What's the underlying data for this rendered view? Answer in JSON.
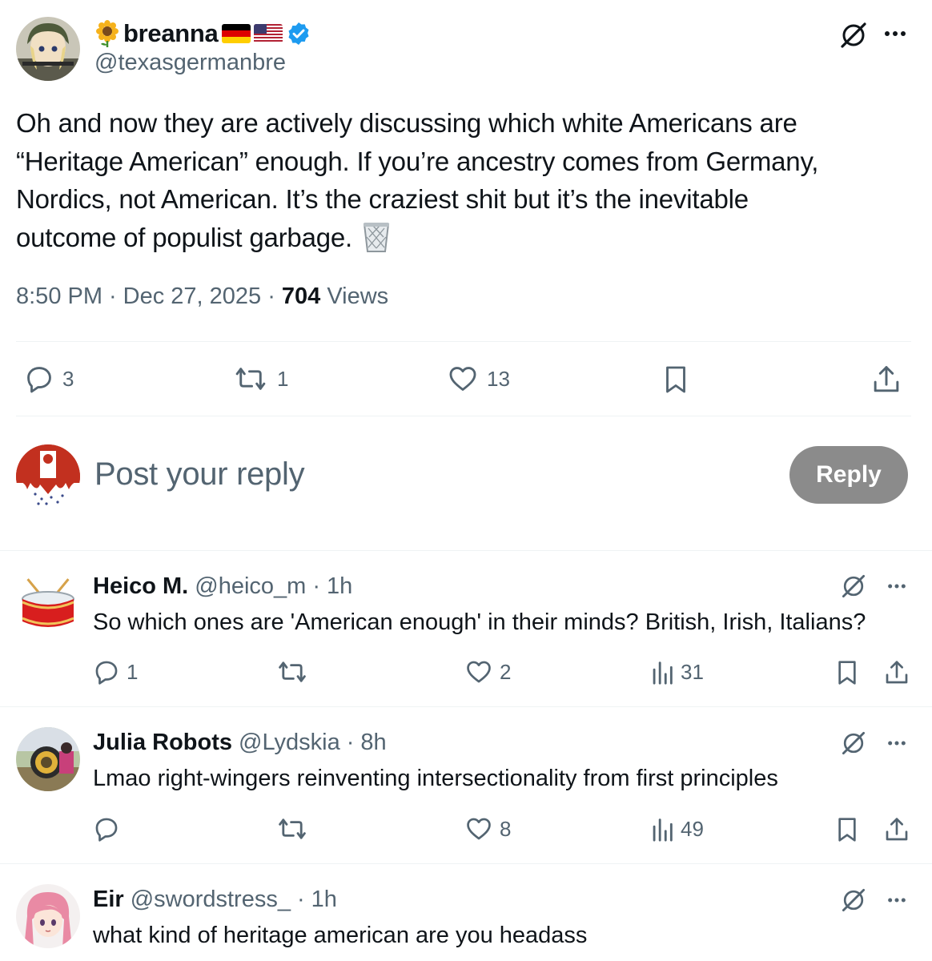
{
  "post": {
    "display_name": "breanna",
    "name_emoji": "sunflower-icon",
    "flags": [
      "germany-flag-icon",
      "us-flag-icon"
    ],
    "verified": "verified-badge-icon",
    "handle": "@texasgermanbre",
    "text_lines": [
      "Oh and now they are actively discussing which white Americans are",
      "“Heritage American” enough. If you’re ancestry comes from Germany,",
      "Nordics, not American. It’s the craziest shit but it’s the inevitable",
      "outcome of populist garbage."
    ],
    "trailing_emoji": "wastebasket-icon",
    "time": "8:50 PM",
    "dot": "·",
    "date": "Dec 27, 2025",
    "views_count": "704",
    "views_label": "Views",
    "stats": {
      "replies": "3",
      "reposts": "1",
      "likes": "13"
    }
  },
  "composer": {
    "placeholder": "Post your reply",
    "button_label": "Reply"
  },
  "replies": [
    {
      "name": "Heico M.",
      "handle": "@heico_m",
      "dot": "·",
      "time": "1h",
      "text": "So which ones are 'American enough' in their minds? British, Irish, Italians?",
      "avatar_icon": "drum-icon",
      "stats": {
        "replies": "1",
        "reposts": "",
        "likes": "2",
        "views": "31"
      }
    },
    {
      "name": "Julia Robots",
      "handle": "@Lydskia",
      "dot": "·",
      "time": "8h",
      "text": "Lmao right-wingers reinventing intersectionality from first principles",
      "avatar_icon": "robot-photo-avatar",
      "stats": {
        "replies": "",
        "reposts": "",
        "likes": "8",
        "views": "49"
      }
    },
    {
      "name": "Eir",
      "handle": "@swordstress_",
      "dot": "·",
      "time": "1h",
      "text": "what kind of heritage american are you headass",
      "avatar_icon": "anime-pink-hair-avatar"
    }
  ],
  "colors": {
    "text": "#0f1419",
    "muted": "#536471",
    "verified": "#1d9bf0",
    "divider": "#eff3f4",
    "reply_button": "#8b8b8b"
  }
}
